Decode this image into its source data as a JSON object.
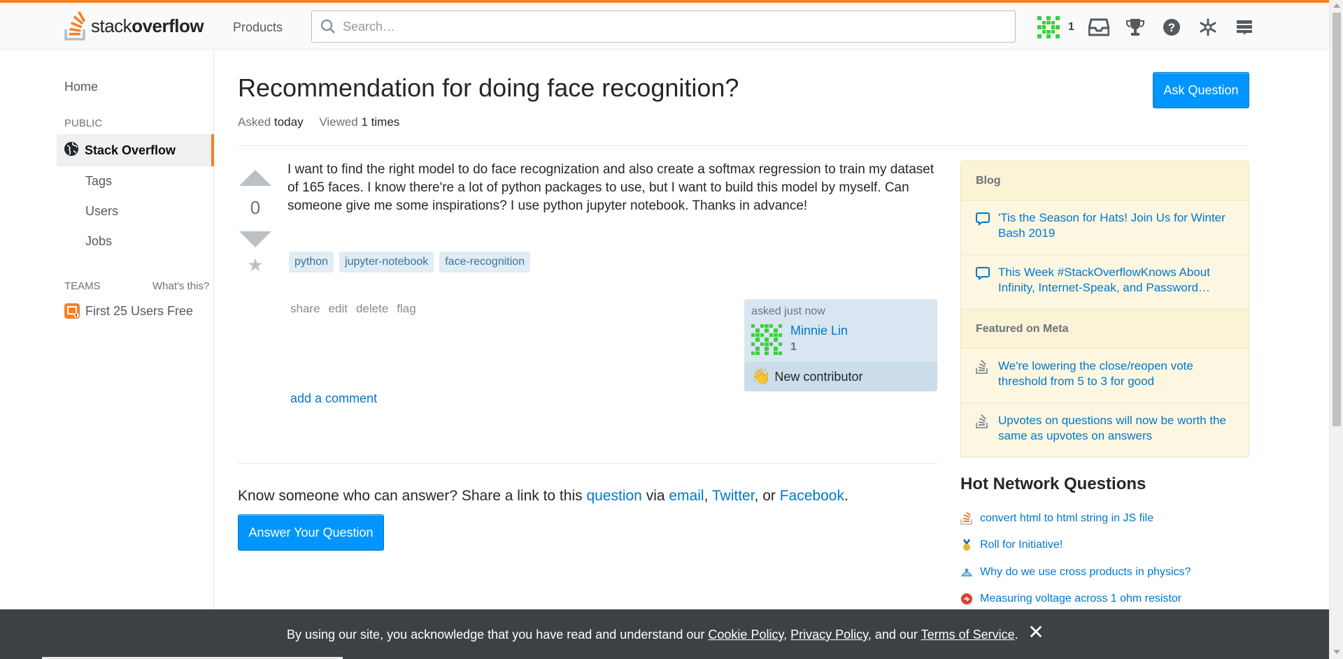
{
  "header": {
    "logo_text_light": "stack",
    "logo_text_bold": "overflow",
    "products_label": "Products",
    "search_placeholder": "Search…",
    "reputation": "1",
    "icons": [
      "avatar",
      "inbox-icon",
      "trophy-icon",
      "help-icon",
      "stackexchange-icon",
      "menu-icon"
    ]
  },
  "leftnav": {
    "home": "Home",
    "public_label": "PUBLIC",
    "stack_overflow": "Stack Overflow",
    "tags": "Tags",
    "users": "Users",
    "jobs": "Jobs",
    "teams_label": "TEAMS",
    "whats_this": "What's this?",
    "first_users_free": "First 25 Users Free"
  },
  "question": {
    "title": "Recommendation for doing face recognition?",
    "ask_button": "Ask Question",
    "asked_label": "Asked",
    "asked_value": "today",
    "viewed_label": "Viewed",
    "viewed_value": "1 times",
    "votes": "0",
    "body": "I want to find the right model to do face recognization and also create a softmax regression to train my dataset of 165 faces. I know there're a lot of python packages to use, but I want to build this model by myself. Can someone give me some inspirations? I use python jupyter notebook. Thanks in advance!",
    "tags": [
      "python",
      "jupyter-notebook",
      "face-recognition"
    ],
    "menu": [
      "share",
      "edit",
      "delete",
      "flag"
    ],
    "owner": {
      "asked_text": "asked just now",
      "name": "Minnie Lin",
      "reputation": "1",
      "new_contributor": "New contributor"
    },
    "add_comment": "add a comment"
  },
  "share": {
    "prefix": "Know someone who can answer? Share a link to this ",
    "question_link": "question",
    "via": " via ",
    "email": "email",
    "comma": ", ",
    "twitter": "Twitter",
    "or": ", or ",
    "facebook": "Facebook",
    "period": ".",
    "answer_button": "Answer Your Question"
  },
  "sidebar": {
    "blog_header": "Blog",
    "blog_items": [
      "'Tis the Season for Hats! Join Us for Winter Bash 2019",
      "This Week #StackOverflowKnows About Infinity, Internet-Speak, and Password…"
    ],
    "meta_header": "Featured on Meta",
    "meta_items": [
      "We're lowering the close/reopen vote threshold from 5 to 3 for good",
      "Upvotes on questions will now be worth the same as upvotes on answers"
    ],
    "hnq_title": "Hot Network Questions",
    "hnq_items": [
      "convert html to html string in JS file",
      "Roll for Initiative!",
      "Why do we use cross products in physics?",
      "Measuring voltage across 1 ohm resistor"
    ]
  },
  "cookie": {
    "prefix": "By using our site, you acknowledge that you have read and understand our ",
    "cookie_policy": "Cookie Policy",
    "sep1": ", ",
    "privacy_policy": "Privacy Policy",
    "sep2": ", and our ",
    "terms": "Terms of Service",
    "suffix": ".",
    "close": "✕"
  },
  "colors": {
    "accent": "#f48024",
    "link": "#0077cc",
    "button": "#0095ff",
    "tag_bg": "#e1ecf4",
    "sidebar_bg": "#fdf7e2"
  }
}
